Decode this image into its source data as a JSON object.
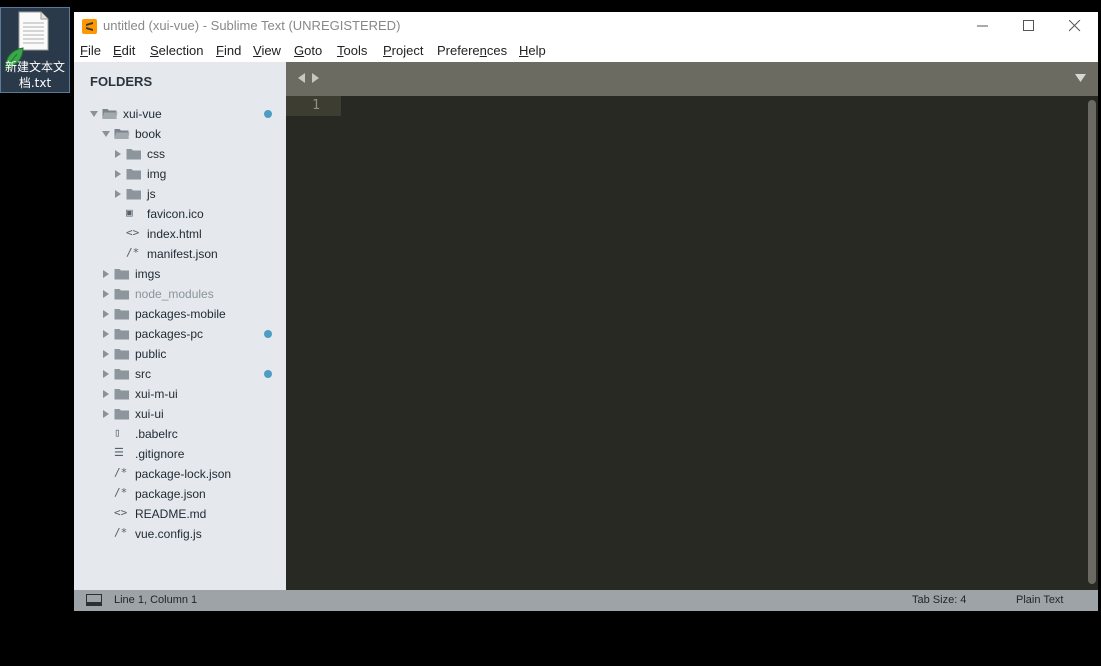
{
  "desktop": {
    "icon_label_line1": "新建文本文",
    "icon_label_line2": "档.txt"
  },
  "window": {
    "title": "untitled (xui-vue) - Sublime Text (UNREGISTERED)",
    "controls": [
      "minimize-icon",
      "maximize-icon",
      "close-icon"
    ]
  },
  "menu": [
    {
      "mn": "F",
      "rest": "ile"
    },
    {
      "mn": "E",
      "rest": "dit"
    },
    {
      "mn": "S",
      "rest": "election"
    },
    {
      "mn": "F",
      "rest": "ind"
    },
    {
      "mn": "V",
      "rest": "iew"
    },
    {
      "mn": "G",
      "rest": "oto"
    },
    {
      "mn": "T",
      "rest": "ools"
    },
    {
      "mn": "P",
      "rest": "roject"
    },
    {
      "pre": "Prefere",
      "mn": "n",
      "rest": "ces"
    },
    {
      "mn": "H",
      "rest": "elp"
    }
  ],
  "sidebar": {
    "title": "FOLDERS",
    "items": [
      {
        "label": "xui-vue",
        "type": "folder-open",
        "depth": 0,
        "dot": true
      },
      {
        "label": "book",
        "type": "folder-open",
        "depth": 1
      },
      {
        "label": "css",
        "type": "folder",
        "depth": 2
      },
      {
        "label": "img",
        "type": "folder",
        "depth": 2
      },
      {
        "label": "js",
        "type": "folder",
        "depth": 2
      },
      {
        "label": "favicon.ico",
        "type": "image",
        "depth": 2
      },
      {
        "label": "index.html",
        "type": "markup",
        "depth": 2
      },
      {
        "label": "manifest.json",
        "type": "script",
        "depth": 2
      },
      {
        "label": "imgs",
        "type": "folder",
        "depth": 1
      },
      {
        "label": "node_modules",
        "type": "folder",
        "depth": 1,
        "dim": true
      },
      {
        "label": "packages-mobile",
        "type": "folder",
        "depth": 1
      },
      {
        "label": "packages-pc",
        "type": "folder",
        "depth": 1,
        "dot": true
      },
      {
        "label": "public",
        "type": "folder",
        "depth": 1
      },
      {
        "label": "src",
        "type": "folder",
        "depth": 1,
        "dot": true
      },
      {
        "label": "xui-m-ui",
        "type": "folder",
        "depth": 1
      },
      {
        "label": "xui-ui",
        "type": "folder",
        "depth": 1
      },
      {
        "label": ".babelrc",
        "type": "file",
        "depth": 1
      },
      {
        "label": ".gitignore",
        "type": "lines",
        "depth": 1
      },
      {
        "label": "package-lock.json",
        "type": "script",
        "depth": 1
      },
      {
        "label": "package.json",
        "type": "script",
        "depth": 1
      },
      {
        "label": "README.md",
        "type": "markup",
        "depth": 1
      },
      {
        "label": "vue.config.js",
        "type": "script",
        "depth": 1
      }
    ]
  },
  "editor": {
    "line_number": "1"
  },
  "status": {
    "position": "Line 1, Column 1",
    "tab_size": "Tab Size: 4",
    "syntax": "Plain Text"
  },
  "colors": {
    "sidebar_bg": "#e5e8ec",
    "editor_bg": "#282923",
    "tabbar_bg": "#6b6b62",
    "dot": "#4e9cc4",
    "statusbar_bg": "#9ea3a8"
  }
}
